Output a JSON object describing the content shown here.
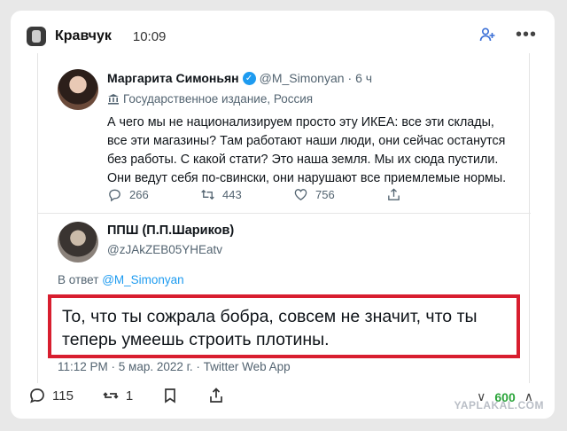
{
  "post": {
    "channel": "Кравчук",
    "time": "10:09"
  },
  "tweet1": {
    "name": "Маргарита Симоньян",
    "handle": "@M_Simonyan",
    "age": "· 6 ч",
    "label": "Государственное издание, Россия",
    "text": "А чего мы не национализируем просто эту ИКЕА: все эти склады, все эти магазины? Там работают наши люди, они сейчас останутся без работы. С какой стати? Это наша земля. Мы их сюда пустили. Они ведут себя по-свински, они нарушают все приемлемые нормы.",
    "replies": "266",
    "retweets": "443",
    "likes": "756"
  },
  "tweet2": {
    "name": "ППШ (П.П.Шариков)",
    "handle": "@zJAkZEB05YHEatv",
    "reply_prefix": "В ответ",
    "reply_to": "@M_Simonyan",
    "text": "То, что ты сожрала бобра, совсем не значит, что ты теперь умеешь строить плотины.",
    "meta": "11:12 PM · 5 мар. 2022 г. · Twitter Web App"
  },
  "footer": {
    "comments": "115",
    "reposts": "1",
    "rating": "600"
  },
  "watermark": "YAPLAKAL.COM",
  "colors": {
    "accent": "#3b6fd6",
    "twitter_blue": "#1d9bf0",
    "highlight_border": "#d81e2f",
    "rating_green": "#2ba53a"
  }
}
